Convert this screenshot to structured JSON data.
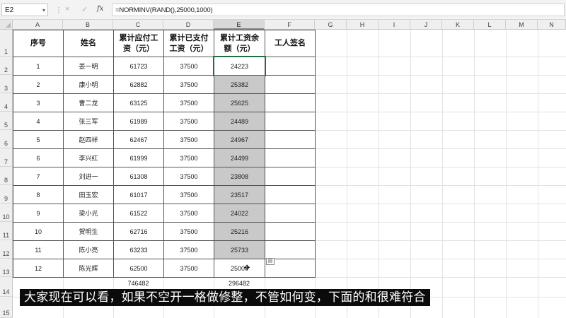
{
  "formula_bar": {
    "name_box": "E2",
    "separator": "⋮",
    "cancel_icon": "×",
    "enter_icon": "✓",
    "fx_label": "fx",
    "formula": "=NORMINV(RAND(),25000,1000)"
  },
  "columns": [
    "A",
    "B",
    "C",
    "D",
    "E",
    "F",
    "G",
    "H",
    "I",
    "J",
    "K",
    "L",
    "M",
    "N"
  ],
  "rows": [
    "1",
    "2",
    "3",
    "4",
    "5",
    "6",
    "7",
    "8",
    "9",
    "10",
    "11",
    "12",
    "13",
    "14",
    "15"
  ],
  "table": {
    "headers": [
      "序号",
      "姓名",
      "累计应付工资（元）",
      "累计已支付工资（元）",
      "累计工资余额（元）",
      "工人签名"
    ],
    "rows": [
      [
        "1",
        "姜一明",
        "61723",
        "37500",
        "24223",
        ""
      ],
      [
        "2",
        "康小明",
        "62882",
        "37500",
        "25382",
        ""
      ],
      [
        "3",
        "曹二龙",
        "63125",
        "37500",
        "25625",
        ""
      ],
      [
        "4",
        "张三军",
        "61989",
        "37500",
        "24489",
        ""
      ],
      [
        "5",
        "赵四祥",
        "62467",
        "37500",
        "24967",
        ""
      ],
      [
        "6",
        "李兴红",
        "61999",
        "37500",
        "24499",
        ""
      ],
      [
        "7",
        "刘进一",
        "61308",
        "37500",
        "23808",
        ""
      ],
      [
        "8",
        "田玉宏",
        "61017",
        "37500",
        "23517",
        ""
      ],
      [
        "9",
        "梁小光",
        "61522",
        "37500",
        "24022",
        ""
      ],
      [
        "10",
        "贺明生",
        "62716",
        "37500",
        "25216",
        ""
      ],
      [
        "11",
        "陈小亮",
        "63233",
        "37500",
        "25733",
        ""
      ],
      [
        "12",
        "陈光辉",
        "62500",
        "37500",
        "25000",
        ""
      ]
    ],
    "totals": {
      "c": "746482",
      "e": "296482"
    }
  },
  "subtitle": "大家现在可以看，如果不空开一格做修整，不管如何变，下面的和很难符合",
  "colors": {
    "selection": "#1e7145",
    "shaded": "#c9c9c9"
  },
  "icons": {
    "paste_options": "paste-options-icon",
    "cursor": "move-cursor-icon"
  }
}
